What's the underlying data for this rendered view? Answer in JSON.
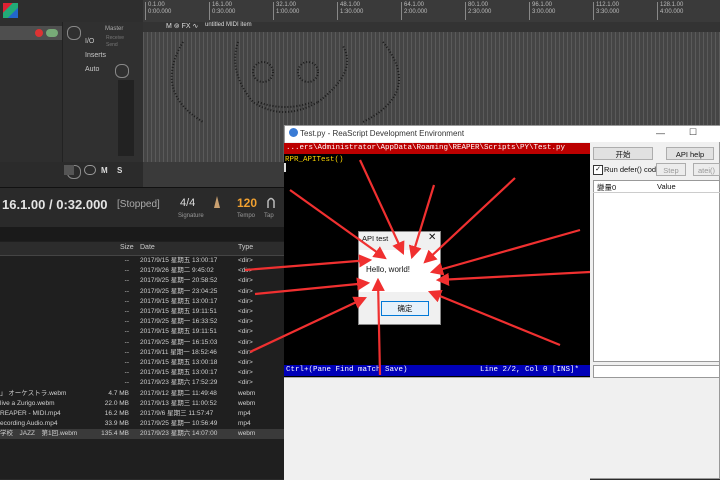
{
  "reaper": {
    "ruler": [
      {
        "bar": "0.1.00",
        "time": "0:00.000"
      },
      {
        "bar": "16.1.00",
        "time": "0:30.000"
      },
      {
        "bar": "32.1.00",
        "time": "1:00.000"
      },
      {
        "bar": "48.1.00",
        "time": "1:30.000"
      },
      {
        "bar": "64.1.00",
        "time": "2:00.000"
      },
      {
        "bar": "80.1.00",
        "time": "2:30.000"
      },
      {
        "bar": "96.1.00",
        "time": "3:00.000"
      },
      {
        "bar": "112.1.00",
        "time": "3:30.000"
      },
      {
        "bar": "128.1.00",
        "time": "4:00.000"
      }
    ],
    "item_label": "untitled MIDI item",
    "item_icons": "M ⊚ FX ∿",
    "master": {
      "label": "Master",
      "io": "I/O",
      "receive": "Receive",
      "send": "Send",
      "inserts": "Inserts",
      "auto": "Auto"
    },
    "transport": {
      "position": "16.1.00 / 0:32.000",
      "state": "[Stopped]",
      "signature": "4/4",
      "signature_label": "Signature",
      "tempo": "120",
      "tempo_label": "Tempo",
      "tap_label": "Tap"
    },
    "mute_label": "M",
    "solo_label": "S"
  },
  "browser": {
    "columns": {
      "size": "Size",
      "date": "Date",
      "type": "Type"
    },
    "rows": [
      {
        "name": "",
        "size": "--",
        "date": "2017/9/15 星期五 13:00:17",
        "type": "<dir>"
      },
      {
        "name": "",
        "size": "--",
        "date": "2017/9/26 星期二 9:45:02",
        "type": "<dir>"
      },
      {
        "name": "",
        "size": "--",
        "date": "2017/9/25 星期一 20:58:52",
        "type": "<dir>"
      },
      {
        "name": "",
        "size": "--",
        "date": "2017/9/25 星期一 23:04:25",
        "type": "<dir>"
      },
      {
        "name": "",
        "size": "--",
        "date": "2017/9/15 星期五 13:00:17",
        "type": "<dir>"
      },
      {
        "name": "",
        "size": "--",
        "date": "2017/9/15 星期五 19:11:51",
        "type": "<dir>"
      },
      {
        "name": "",
        "size": "--",
        "date": "2017/9/25 星期一 16:33:52",
        "type": "<dir>"
      },
      {
        "name": "",
        "size": "--",
        "date": "2017/9/15 星期五 19:11:51",
        "type": "<dir>"
      },
      {
        "name": "",
        "size": "--",
        "date": "2017/9/25 星期一 16:15:03",
        "type": "<dir>"
      },
      {
        "name": "",
        "size": "--",
        "date": "2017/9/11 星期一 18:52:46",
        "type": "<dir>"
      },
      {
        "name": "",
        "size": "--",
        "date": "2017/9/15 星期五 13:00:18",
        "type": "<dir>"
      },
      {
        "name": "",
        "size": "--",
        "date": "2017/9/15 星期五 13:00:17",
        "type": "<dir>"
      },
      {
        "name": "",
        "size": "--",
        "date": "2017/9/23 星期六 17:52:29",
        "type": "<dir>"
      },
      {
        "name": "」 オーケストラ.webm",
        "size": "4.7 MB",
        "date": "2017/9/12 星期二 11:49:48",
        "type": "webm"
      },
      {
        "name": "live a Zurigo.webm",
        "size": "22.0 MB",
        "date": "2017/9/13 星期三 11:00:52",
        "type": "webm"
      },
      {
        "name": "REAPER - MIDI.mp4",
        "size": "16.2 MB",
        "date": "2017/9/6 星期三 11:57:47",
        "type": "mp4"
      },
      {
        "name": "ecording Audio.mp4",
        "size": "33.9 MB",
        "date": "2017/9/25 星期一 10:56:49",
        "type": "mp4"
      },
      {
        "name": "学校　JAZZ　第1回.webm",
        "size": "135.4 MB",
        "date": "2017/9/23 星期六 14:07:00",
        "type": "webm"
      }
    ]
  },
  "ide": {
    "title": "Test.py - ReaScript Development Environment",
    "path": "...ers\\Administrator\\AppData\\Roaming\\REAPER\\Scripts\\PY\\Test.py",
    "code": "RPR_APITest()",
    "status_left": "Ctrl+(Pane Find maTch Save)",
    "status_right": "Line 2/2, Col 0 [INS]*",
    "buttons": {
      "start": "开始",
      "api_help": "API help",
      "step": "Step",
      "watch": "atei()"
    },
    "checkbox_label": "Run defer() code",
    "checkbox_checked": "✓",
    "vars_headers": {
      "name": "變量0",
      "value": "Value"
    },
    "min_icon": "—",
    "max_icon": "☐"
  },
  "msgbox": {
    "title": "API test",
    "close": "✕",
    "text": "Hello, world!",
    "ok": "确定"
  }
}
